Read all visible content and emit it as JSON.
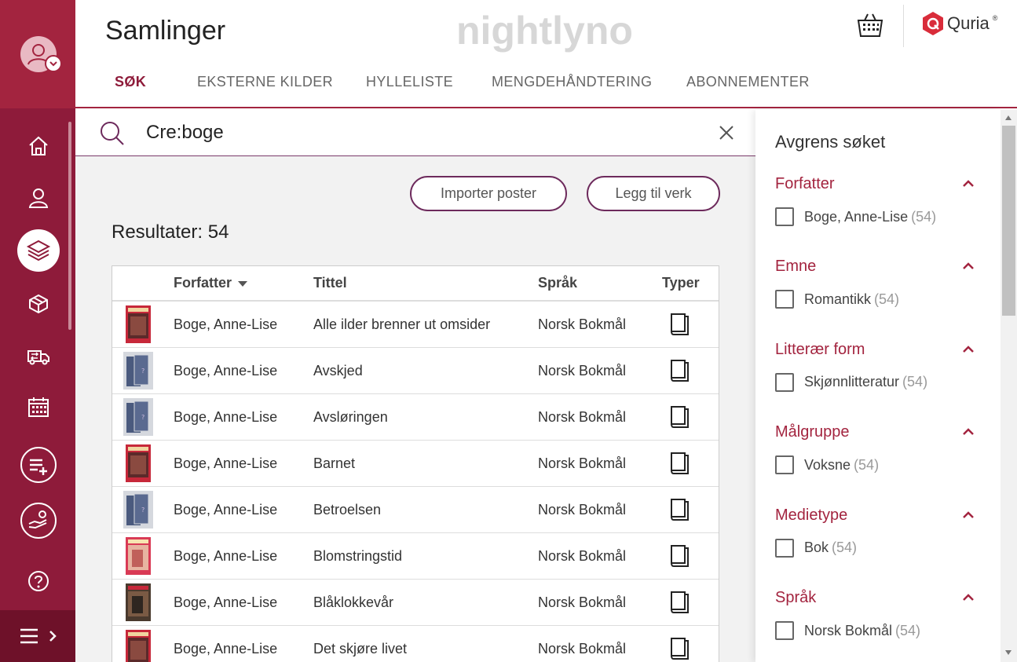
{
  "header": {
    "title": "Samlinger",
    "brand": "nightlyno",
    "vendor": "Quria",
    "vendor_mark": "®"
  },
  "tabs": [
    {
      "label": "SØK",
      "active": true
    },
    {
      "label": "EKSTERNE KILDER",
      "active": false
    },
    {
      "label": "HYLLELISTE",
      "active": false
    },
    {
      "label": "MENGDEHÅNDTERING",
      "active": false
    },
    {
      "label": "ABONNEMENTER",
      "active": false
    }
  ],
  "sidebar": {
    "items": [
      {
        "name": "home-icon"
      },
      {
        "name": "user-icon"
      },
      {
        "name": "layers-icon",
        "active": true
      },
      {
        "name": "box-icon"
      },
      {
        "name": "transfer-truck-icon"
      },
      {
        "name": "calendar-icon"
      },
      {
        "name": "add-list-icon"
      },
      {
        "name": "hand-coin-icon"
      },
      {
        "name": "help-icon"
      }
    ],
    "menu_icon": "menu-expand-icon"
  },
  "search": {
    "value": "Cre:boge"
  },
  "actions": {
    "import_label": "Importer poster",
    "add_work_label": "Legg til verk"
  },
  "results": {
    "label": "Resultater: 54"
  },
  "table": {
    "headers": {
      "author": "Forfatter",
      "title": "Tittel",
      "language": "Språk",
      "types": "Typer"
    },
    "rows": [
      {
        "cover": "photo-red",
        "author": "Boge, Anne-Lise",
        "title": "Alle ilder brenner ut omsider",
        "language": "Norsk Bokmål",
        "type": "book-icon"
      },
      {
        "cover": "placeholder",
        "author": "Boge, Anne-Lise",
        "title": "Avskjed",
        "language": "Norsk Bokmål",
        "type": "book-icon"
      },
      {
        "cover": "placeholder",
        "author": "Boge, Anne-Lise",
        "title": "Avsløringen",
        "language": "Norsk Bokmål",
        "type": "book-icon"
      },
      {
        "cover": "photo-red",
        "author": "Boge, Anne-Lise",
        "title": "Barnet",
        "language": "Norsk Bokmål",
        "type": "book-icon"
      },
      {
        "cover": "placeholder",
        "author": "Boge, Anne-Lise",
        "title": "Betroelsen",
        "language": "Norsk Bokmål",
        "type": "book-icon"
      },
      {
        "cover": "photo-pink",
        "author": "Boge, Anne-Lise",
        "title": "Blomstringstid",
        "language": "Norsk Bokmål",
        "type": "book-icon"
      },
      {
        "cover": "photo-dark",
        "author": "Boge, Anne-Lise",
        "title": "Blåklokkevår",
        "language": "Norsk Bokmål",
        "type": "book-icon"
      },
      {
        "cover": "photo-red",
        "author": "Boge, Anne-Lise",
        "title": "Det skjøre livet",
        "language": "Norsk Bokmål",
        "type": "book-icon"
      }
    ]
  },
  "filter": {
    "title": "Avgrens søket",
    "groups": [
      {
        "title": "Forfatter",
        "option": "Boge, Anne-Lise",
        "count": "(54)"
      },
      {
        "title": "Emne",
        "option": "Romantikk",
        "count": "(54)"
      },
      {
        "title": "Litterær form",
        "option": "Skjønnlitteratur",
        "count": "(54)"
      },
      {
        "title": "Målgruppe",
        "option": "Voksne",
        "count": "(54)"
      },
      {
        "title": "Medietype",
        "option": "Bok",
        "count": "(54)"
      },
      {
        "title": "Språk",
        "option": "Norsk Bokmål",
        "count": "(54)"
      }
    ]
  },
  "colors": {
    "accent": "#8e1b3a",
    "accent_light": "#a3243f",
    "button_border": "#6d2a5c"
  }
}
